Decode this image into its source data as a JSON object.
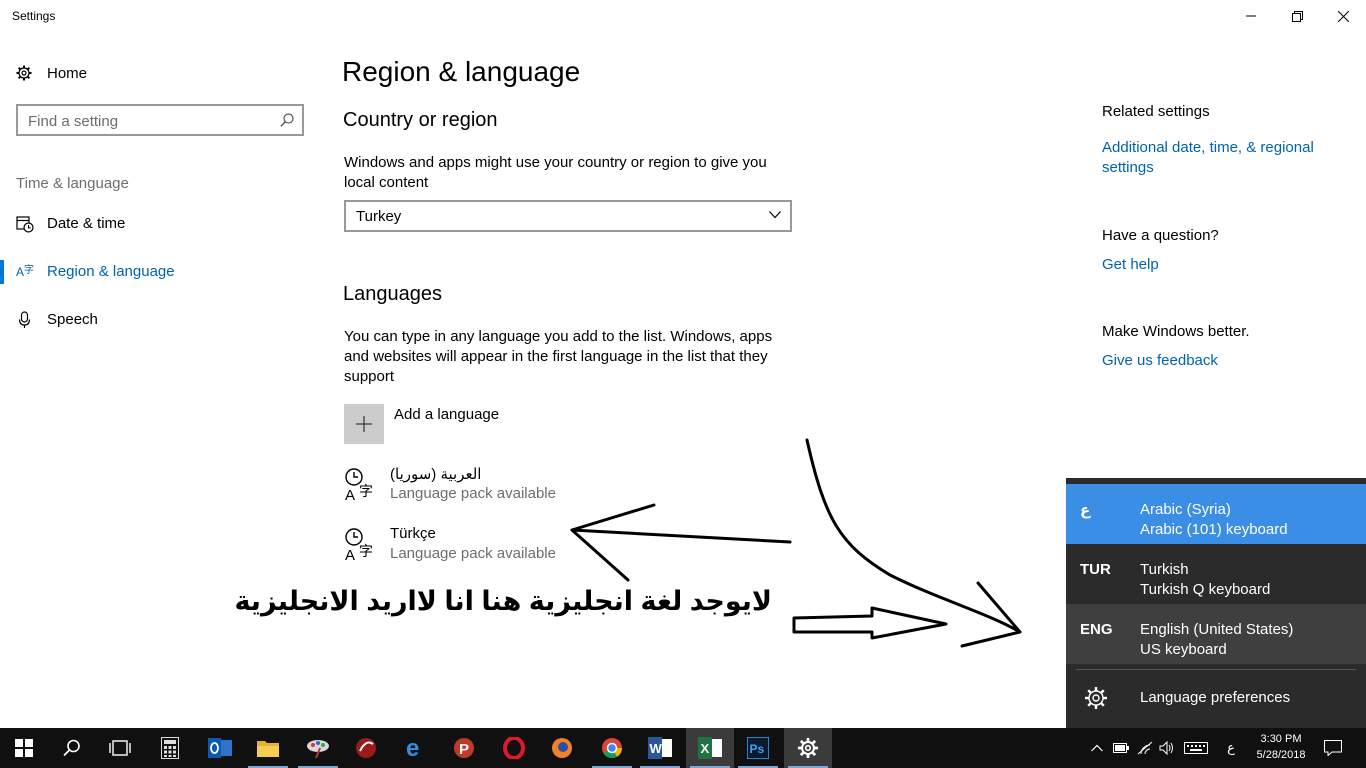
{
  "window": {
    "title": "Settings",
    "minimize_icon": "minimize-icon",
    "maximize_icon": "restore-icon",
    "close_icon": "close-icon"
  },
  "sidebar": {
    "home_label": "Home",
    "search_placeholder": "Find a setting",
    "group_label": "Time & language",
    "items": [
      {
        "label": "Date & time",
        "icon": "calendar-clock-icon",
        "active": false
      },
      {
        "label": "Region & language",
        "icon": "region-language-icon",
        "active": true
      },
      {
        "label": "Speech",
        "icon": "microphone-icon",
        "active": false
      }
    ],
    "accent": "#0078d7"
  },
  "main": {
    "title": "Region & language",
    "country_section": {
      "title": "Country or region",
      "description": "Windows and apps might use your country or region to give you local content",
      "selected_country": "Turkey"
    },
    "languages_section": {
      "title": "Languages",
      "description": "You can type in any language you add to the list. Windows, apps and websites will appear in the first language in the list that they support",
      "add_label": "Add a language",
      "languages": [
        {
          "name": "العربية (سوريا)",
          "status": "Language pack available"
        },
        {
          "name": "Türkçe",
          "status": "Language pack available"
        }
      ]
    }
  },
  "related": {
    "heading": "Related settings",
    "link_regional": "Additional date, time, & regional settings",
    "question_heading": "Have a question?",
    "help_link": "Get help",
    "better_heading": "Make Windows better.",
    "feedback_link": "Give us feedback",
    "link_color": "#0063b1"
  },
  "annotation": {
    "text": "لايوجد  لغة انجليزية هنا  انا لااريد الانجليزية"
  },
  "language_flyout": {
    "items": [
      {
        "code": "ع",
        "name": "Arabic (Syria)",
        "keyboard": "Arabic (101) keyboard",
        "selected": true
      },
      {
        "code": "TUR",
        "name": "Turkish",
        "keyboard": "Turkish Q keyboard",
        "selected": false
      },
      {
        "code": "ENG",
        "name": "English (United States)",
        "keyboard": "US keyboard",
        "selected": false
      }
    ],
    "preferences_label": "Language preferences",
    "selected_color": "#3a8ee6",
    "background_color": "#2b2b2b"
  },
  "taskbar": {
    "apps": [
      "start-icon",
      "search-icon",
      "task-view-icon",
      "calculator-icon",
      "outlook-icon",
      "file-explorer-icon",
      "paint-app-icon",
      "media-app-icon",
      "edge-icon",
      "psiphon-icon",
      "opera-icon",
      "firefox-icon",
      "chrome-icon",
      "word-icon",
      "excel-icon",
      "photoshop-icon",
      "settings-icon"
    ],
    "tray_language": "ع",
    "time": "3:30 PM",
    "date": "5/28/2018"
  }
}
